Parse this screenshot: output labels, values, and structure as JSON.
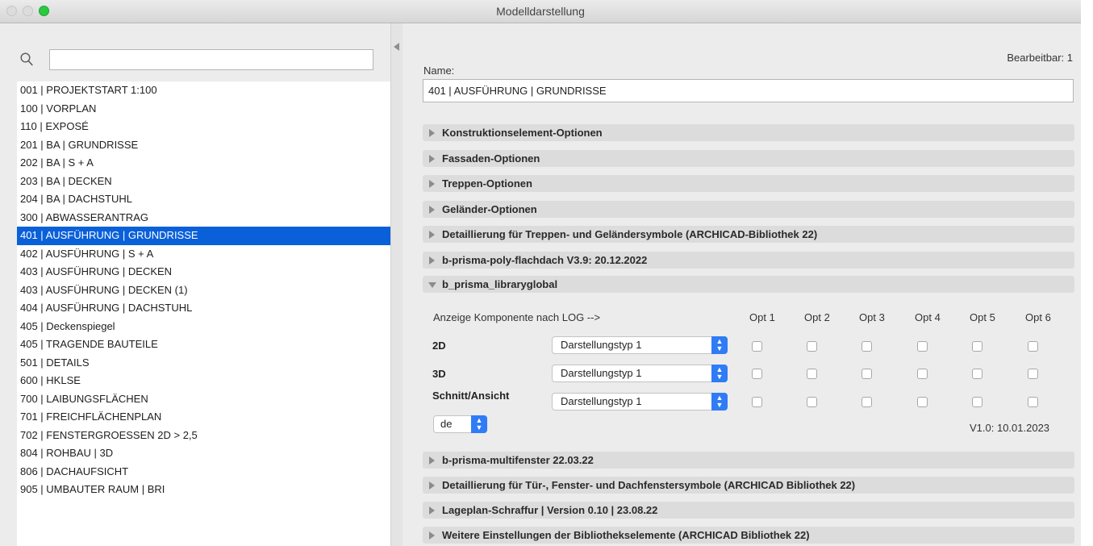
{
  "window": {
    "title": "Modelldarstellung"
  },
  "search": {
    "value": "",
    "placeholder": ""
  },
  "list": {
    "selected_index": 8,
    "items": [
      "001 | PROJEKTSTART 1:100",
      "100 | VORPLAN",
      "110 | EXPOSÉ",
      "201 | BA | GRUNDRISSE",
      "202 | BA | S + A",
      "203 | BA | DECKEN",
      "204 | BA | DACHSTUHL",
      "300 | ABWASSERANTRAG",
      "401 | AUSFÜHRUNG | GRUNDRISSE",
      "402 | AUSFÜHRUNG | S + A",
      "403 | AUSFÜHRUNG | DECKEN",
      "403 | AUSFÜHRUNG | DECKEN (1)",
      "404 | AUSFÜHRUNG | DACHSTUHL",
      "405 | Deckenspiegel",
      "405 | TRAGENDE BAUTEILE",
      "501 | DETAILS",
      "600 | HKLSE",
      "700 | LAIBUNGSFLÄCHEN",
      "701 | FREICHFLÄCHENPLAN",
      "702 | FENSTERGROESSEN 2D > 2,5",
      "804 | ROHBAU | 3D",
      "806 | DACHAUFSICHT",
      "905 | UMBAUTER RAUM | BRI"
    ]
  },
  "detail": {
    "editable": "Bearbeitbar: 1",
    "name_label": "Name:",
    "name_value": "401 | AUSFÜHRUNG | GRUNDRISSE",
    "sections_top": [
      "Konstruktionselement-Optionen",
      "Fassaden-Optionen",
      "Treppen-Optionen",
      "Geländer-Optionen",
      "Detaillierung für Treppen- und Geländersymbole (ARCHICAD-Bibliothek 22)",
      "b-prisma-poly-flachdach V3.9: 20.12.2022"
    ],
    "open_section": "b_prisma_libraryglobal",
    "global": {
      "header": "Anzeige Komponente nach LOG -->",
      "options": [
        "Opt 1",
        "Opt 2",
        "Opt 3",
        "Opt 4",
        "Opt 5",
        "Opt 6"
      ],
      "rows": [
        {
          "label": "2D",
          "select": "Darstellungstyp 1"
        },
        {
          "label": "3D",
          "select": "Darstellungstyp 1"
        },
        {
          "label": "Schnitt/Ansicht",
          "select": "Darstellungstyp 1"
        }
      ],
      "language": "de",
      "version": "V1.0: 10.01.2023"
    },
    "sections_bottom": [
      "b-prisma-multifenster 22.03.22",
      "Detaillierung für Tür-, Fenster- und Dachfenstersymbole (ARCHICAD Bibliothek 22)",
      "Lageplan-Schraffur | Version 0.10 | 23.08.22",
      "Weitere Einstellungen der Bibliothekselemente (ARCHICAD Bibliothek 22)"
    ]
  },
  "colors": {
    "selection": "#0a60d9",
    "accent": "#2f7cf6",
    "zoom_button": "#2bc840"
  }
}
